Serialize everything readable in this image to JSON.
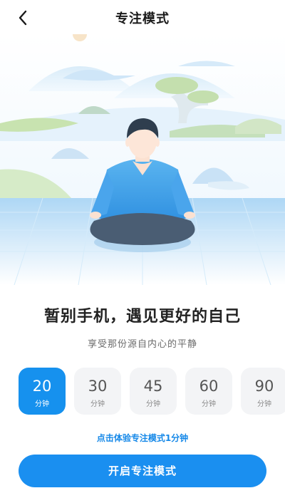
{
  "header": {
    "title": "专注模式",
    "back_icon": "chevron-left-icon"
  },
  "hero": {
    "headline": "暂别手机，遇见更好的自己",
    "subline": "享受那份源自内心的平静"
  },
  "durations": [
    {
      "value": "20",
      "unit": "分钟",
      "selected": true
    },
    {
      "value": "30",
      "unit": "分钟",
      "selected": false
    },
    {
      "value": "45",
      "unit": "分钟",
      "selected": false
    },
    {
      "value": "60",
      "unit": "分钟",
      "selected": false
    },
    {
      "value": "90",
      "unit": "分钟",
      "selected": false
    }
  ],
  "trial_link": "点击体验专注模式1分钟",
  "start_button": "开启专注模式",
  "colors": {
    "accent": "#1691ee",
    "card_bg": "#f3f4f6",
    "link": "#1588e8"
  }
}
